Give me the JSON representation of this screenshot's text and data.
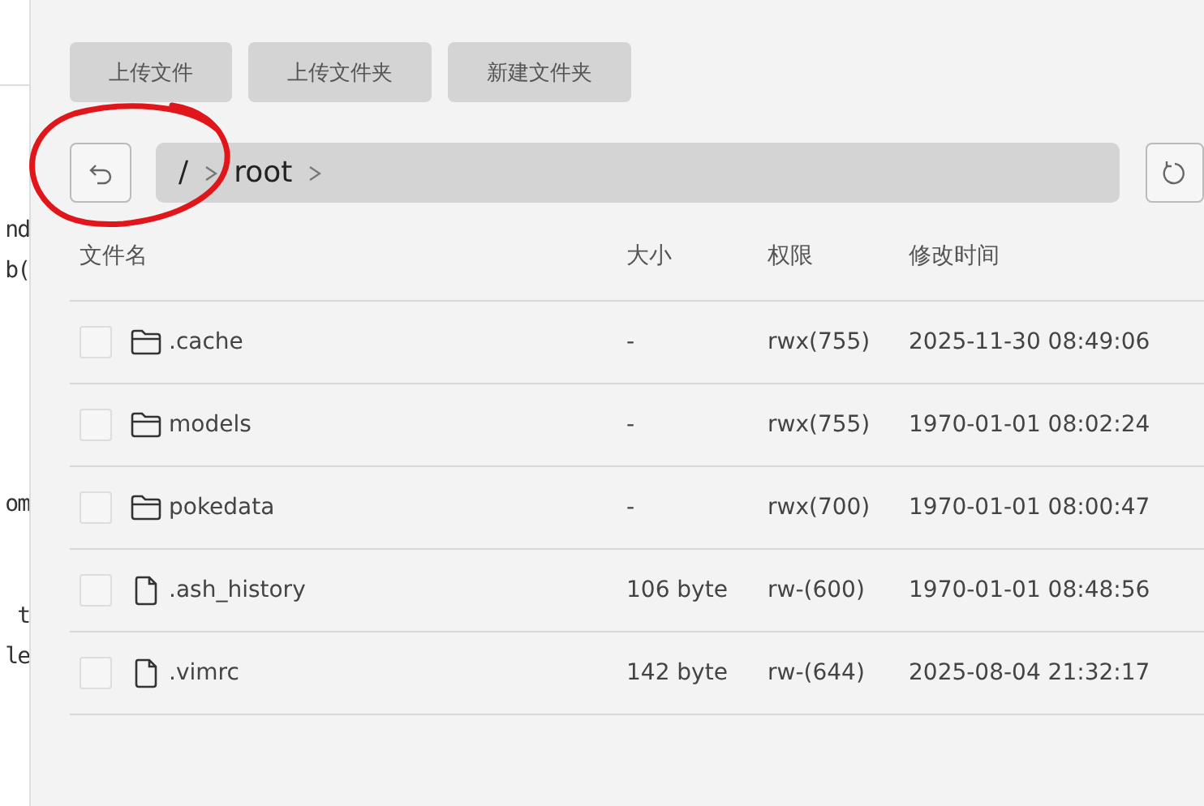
{
  "code_fragments": [
    "nd",
    "b(",
    "om",
    "t",
    "le"
  ],
  "toolbar": {
    "buttons": [
      "上传文件",
      "上传文件夹",
      "新建文件夹"
    ]
  },
  "breadcrumb": [
    "/",
    "root"
  ],
  "table": {
    "columns": [
      "文件名",
      "大小",
      "权限",
      "修改时间"
    ],
    "rows": [
      {
        "kind": "folder",
        "name": ".cache",
        "size": "-",
        "permissions": "rwx(755)",
        "modified": "2025-11-30 08:49:06",
        "checked": false
      },
      {
        "kind": "folder",
        "name": "models",
        "size": "-",
        "permissions": "rwx(755)",
        "modified": "1970-01-01 08:02:24",
        "checked": false
      },
      {
        "kind": "folder",
        "name": "pokedata",
        "size": "-",
        "permissions": "rwx(700)",
        "modified": "1970-01-01 08:00:47",
        "checked": false
      },
      {
        "kind": "file",
        "name": ".ash_history",
        "size": "106 byte",
        "permissions": "rw-(600)",
        "modified": "1970-01-01 08:48:56",
        "checked": false
      },
      {
        "kind": "file",
        "name": ".vimrc",
        "size": "142 byte",
        "permissions": "rw-(644)",
        "modified": "2025-08-04 21:32:17",
        "checked": false
      }
    ]
  }
}
